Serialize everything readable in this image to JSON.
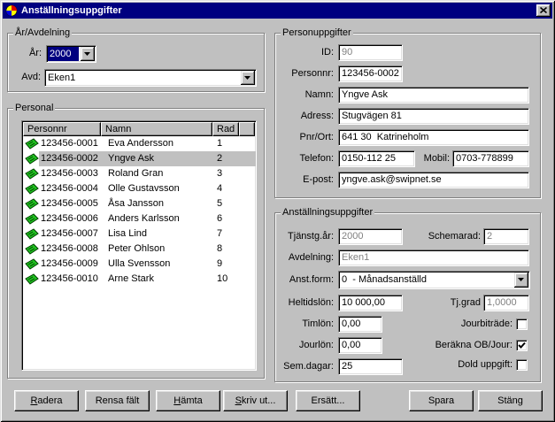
{
  "window": {
    "title": "Anställningsuppgifter",
    "icon": "app-icon",
    "close_icon": "close-icon"
  },
  "year_department": {
    "legend": "År/Avdelning",
    "year_label": "År:",
    "year_value": "2000",
    "department_label": "Avd:",
    "department_value": "Eken1"
  },
  "staff": {
    "legend": "Personal",
    "columns": {
      "personnr": "Personnr",
      "namn": "Namn",
      "rad": "Rad"
    },
    "row_icon": "person-card-icon",
    "selected_index": 1,
    "rows": [
      {
        "personnr": "123456-0001",
        "namn": "Eva Andersson",
        "rad": "1"
      },
      {
        "personnr": "123456-0002",
        "namn": "Yngve Ask",
        "rad": "2"
      },
      {
        "personnr": "123456-0003",
        "namn": "Roland Gran",
        "rad": "3"
      },
      {
        "personnr": "123456-0004",
        "namn": "Olle Gustavsson",
        "rad": "4"
      },
      {
        "personnr": "123456-0005",
        "namn": "Åsa Jansson",
        "rad": "5"
      },
      {
        "personnr": "123456-0006",
        "namn": "Anders Karlsson",
        "rad": "6"
      },
      {
        "personnr": "123456-0007",
        "namn": "Lisa Lind",
        "rad": "7"
      },
      {
        "personnr": "123456-0008",
        "namn": "Peter Ohlson",
        "rad": "8"
      },
      {
        "personnr": "123456-0009",
        "namn": "Ulla Svensson",
        "rad": "9"
      },
      {
        "personnr": "123456-0010",
        "namn": "Arne Stark",
        "rad": "10"
      }
    ]
  },
  "personal_details": {
    "legend": "Personuppgifter",
    "id": {
      "label": "ID:",
      "value": "90",
      "disabled": true
    },
    "personnr": {
      "label": "Personnr:",
      "value": "123456-0002"
    },
    "namn": {
      "label": "Namn:",
      "value": "Yngve Ask"
    },
    "adress": {
      "label": "Adress:",
      "value": "Stugvägen 81"
    },
    "pnr_ort": {
      "label": "Pnr/Ort:",
      "value": "641 30  Katrineholm"
    },
    "telefon": {
      "label": "Telefon:",
      "value": "0150-112 25"
    },
    "mobil": {
      "label": "Mobil:",
      "value": "0703-778899"
    },
    "epost": {
      "label": "E-post:",
      "value": "yngve.ask@swipnet.se"
    }
  },
  "employment": {
    "legend": "Anställningsuppgifter",
    "tjanstgar": {
      "label": "Tjänstg.år:",
      "value": "2000",
      "disabled": true
    },
    "schemarad": {
      "label": "Schemarad:",
      "value": "2",
      "disabled": true
    },
    "avdelning": {
      "label": "Avdelning:",
      "value": "Eken1",
      "disabled": true
    },
    "anstform": {
      "label": "Anst.form:",
      "value": "0  - Månadsanställd"
    },
    "heltidslon": {
      "label": "Heltidslön:",
      "value": "10 000,00"
    },
    "tjgrad": {
      "label": "Tj.grad",
      "value": "1,0000",
      "disabled": true
    },
    "timlon": {
      "label": "Timlön:",
      "value": "0,00"
    },
    "jourlon": {
      "label": "Jourlön:",
      "value": "0,00"
    },
    "semdagar": {
      "label": "Sem.dagar:",
      "value": "25"
    },
    "jourbitrade": {
      "label": "Jourbiträde:",
      "checked": false
    },
    "berakna_ob": {
      "label": "Beräkna OB/Jour:",
      "checked": true
    },
    "dold_uppgift": {
      "label": "Dold uppgift:",
      "checked": false
    }
  },
  "buttons": {
    "radera": "Radera",
    "rensa": "Rensa fält",
    "hamta": "Hämta",
    "skriv_ut": "Skriv ut...",
    "ersatt": "Ersätt...",
    "spara": "Spara",
    "stang": "Stäng"
  },
  "colors": {
    "title_bar": "#000080",
    "face": "#c0c0c0",
    "text_selection": "#000080",
    "selected_row": "#c0c0c0",
    "disabled_text": "#808080",
    "row_icon": "#20c020"
  }
}
